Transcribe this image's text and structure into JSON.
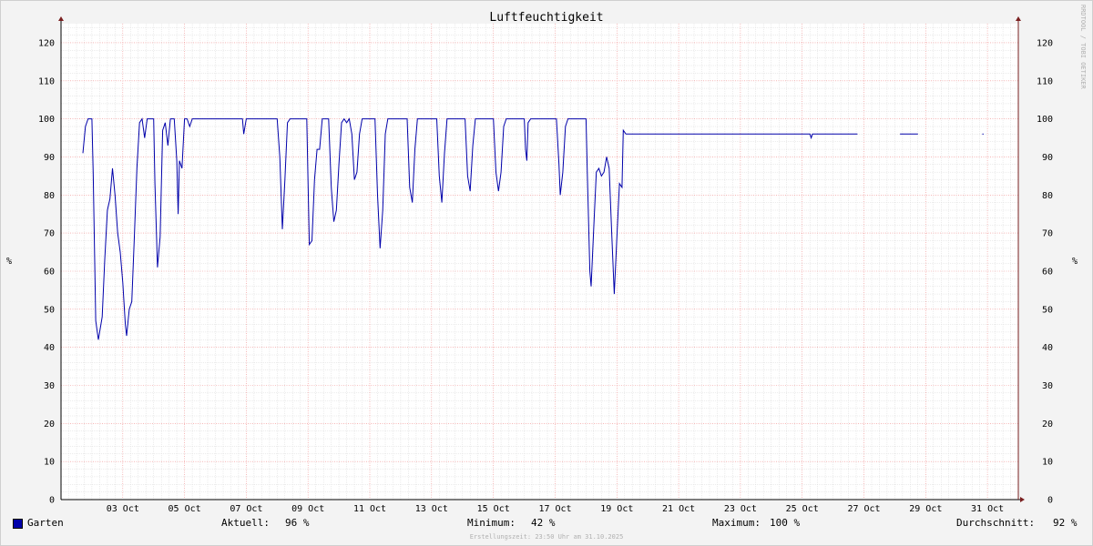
{
  "chart_data": {
    "type": "line",
    "title": "Luftfeuchtigkeit",
    "ylabel": "%",
    "ylim": [
      0,
      125
    ],
    "yticks": [
      0,
      10,
      20,
      30,
      40,
      50,
      60,
      70,
      80,
      90,
      100,
      110,
      120
    ],
    "xlim": [
      "01 Oct",
      "31 Oct 23:59"
    ],
    "xticks": [
      "03 Oct",
      "05 Oct",
      "07 Oct",
      "09 Oct",
      "11 Oct",
      "13 Oct",
      "15 Oct",
      "17 Oct",
      "19 Oct",
      "21 Oct",
      "23 Oct",
      "25 Oct",
      "27 Oct",
      "29 Oct",
      "31 Oct"
    ],
    "grid": true,
    "series": [
      {
        "name": "Garten",
        "color": "#0000aa",
        "segments": [
          [
            [
              "01 Oct 17:00",
              91
            ],
            [
              "01 Oct 19:00",
              98
            ],
            [
              "01 Oct 21:00",
              100
            ],
            [
              "02 Oct 00:00",
              100
            ],
            [
              "02 Oct 01:00",
              86
            ],
            [
              "02 Oct 03:00",
              47
            ],
            [
              "02 Oct 05:00",
              42
            ],
            [
              "02 Oct 08:00",
              48
            ],
            [
              "02 Oct 10:00",
              63
            ],
            [
              "02 Oct 12:00",
              76
            ],
            [
              "02 Oct 14:00",
              79
            ],
            [
              "02 Oct 16:00",
              87
            ],
            [
              "02 Oct 18:00",
              80
            ],
            [
              "02 Oct 20:00",
              70
            ],
            [
              "02 Oct 22:00",
              65
            ],
            [
              "03 Oct 00:00",
              57
            ],
            [
              "03 Oct 02:00",
              46
            ],
            [
              "03 Oct 03:00",
              43
            ],
            [
              "03 Oct 05:00",
              50
            ],
            [
              "03 Oct 07:00",
              52
            ],
            [
              "03 Oct 09:00",
              69
            ],
            [
              "03 Oct 11:00",
              87
            ],
            [
              "03 Oct 13:00",
              99
            ],
            [
              "03 Oct 15:00",
              100
            ],
            [
              "03 Oct 17:00",
              95
            ],
            [
              "03 Oct 19:00",
              100
            ],
            [
              "04 Oct 00:00",
              100
            ],
            [
              "04 Oct 01:00",
              83
            ],
            [
              "04 Oct 03:00",
              61
            ],
            [
              "04 Oct 05:00",
              69
            ],
            [
              "04 Oct 07:00",
              97
            ],
            [
              "04 Oct 09:00",
              99
            ],
            [
              "04 Oct 11:00",
              93
            ],
            [
              "04 Oct 13:00",
              100
            ],
            [
              "04 Oct 16:00",
              100
            ],
            [
              "04 Oct 18:00",
              89
            ],
            [
              "04 Oct 19:00",
              75
            ],
            [
              "04 Oct 20:00",
              89
            ],
            [
              "04 Oct 22:00",
              87
            ],
            [
              "05 Oct 00:00",
              100
            ],
            [
              "05 Oct 02:00",
              100
            ],
            [
              "05 Oct 04:00",
              98
            ],
            [
              "05 Oct 06:00",
              100
            ],
            [
              "06 Oct 21:00",
              100
            ],
            [
              "06 Oct 22:00",
              96
            ],
            [
              "07 Oct 00:00",
              100
            ],
            [
              "08 Oct 00:00",
              100
            ],
            [
              "08 Oct 02:00",
              90
            ],
            [
              "08 Oct 04:00",
              71
            ],
            [
              "08 Oct 06:00",
              84
            ],
            [
              "08 Oct 08:00",
              99
            ],
            [
              "08 Oct 10:00",
              100
            ],
            [
              "08 Oct 23:00",
              100
            ],
            [
              "09 Oct 01:00",
              67
            ],
            [
              "09 Oct 03:00",
              68
            ],
            [
              "09 Oct 05:00",
              84
            ],
            [
              "09 Oct 07:00",
              92
            ],
            [
              "09 Oct 09:00",
              92
            ],
            [
              "09 Oct 11:00",
              100
            ],
            [
              "09 Oct 16:00",
              100
            ],
            [
              "09 Oct 18:00",
              82
            ],
            [
              "09 Oct 20:00",
              73
            ],
            [
              "09 Oct 22:00",
              76
            ],
            [
              "10 Oct 00:00",
              88
            ],
            [
              "10 Oct 02:00",
              99
            ],
            [
              "10 Oct 04:00",
              100
            ],
            [
              "10 Oct 06:00",
              99
            ],
            [
              "10 Oct 08:00",
              100
            ],
            [
              "10 Oct 10:00",
              96
            ],
            [
              "10 Oct 12:00",
              84
            ],
            [
              "10 Oct 14:00",
              86
            ],
            [
              "10 Oct 16:00",
              96
            ],
            [
              "10 Oct 18:00",
              100
            ],
            [
              "11 Oct 04:00",
              100
            ],
            [
              "11 Oct 06:00",
              80
            ],
            [
              "11 Oct 08:00",
              66
            ],
            [
              "11 Oct 10:00",
              76
            ],
            [
              "11 Oct 12:00",
              96
            ],
            [
              "11 Oct 14:00",
              100
            ],
            [
              "12 Oct 05:00",
              100
            ],
            [
              "12 Oct 07:00",
              82
            ],
            [
              "12 Oct 09:00",
              78
            ],
            [
              "12 Oct 11:00",
              92
            ],
            [
              "12 Oct 13:00",
              100
            ],
            [
              "13 Oct 04:00",
              100
            ],
            [
              "13 Oct 06:00",
              85
            ],
            [
              "13 Oct 08:00",
              78
            ],
            [
              "13 Oct 10:00",
              91
            ],
            [
              "13 Oct 12:00",
              100
            ],
            [
              "14 Oct 02:00",
              100
            ],
            [
              "14 Oct 04:00",
              85
            ],
            [
              "14 Oct 06:00",
              81
            ],
            [
              "14 Oct 08:00",
              93
            ],
            [
              "14 Oct 10:00",
              100
            ],
            [
              "15 Oct 00:00",
              100
            ],
            [
              "15 Oct 02:00",
              86
            ],
            [
              "15 Oct 04:00",
              81
            ],
            [
              "15 Oct 06:00",
              86
            ],
            [
              "15 Oct 08:00",
              98
            ],
            [
              "15 Oct 10:00",
              100
            ],
            [
              "16 Oct 00:00",
              100
            ],
            [
              "16 Oct 01:00",
              92
            ],
            [
              "16 Oct 02:00",
              89
            ],
            [
              "16 Oct 03:00",
              99
            ],
            [
              "16 Oct 05:00",
              100
            ],
            [
              "17 Oct 01:00",
              100
            ],
            [
              "17 Oct 03:00",
              88
            ],
            [
              "17 Oct 04:00",
              80
            ],
            [
              "17 Oct 06:00",
              86
            ],
            [
              "17 Oct 08:00",
              98
            ],
            [
              "17 Oct 10:00",
              100
            ],
            [
              "18 Oct 00:00",
              100
            ],
            [
              "18 Oct 01:00",
              86
            ],
            [
              "18 Oct 03:00",
              60
            ],
            [
              "18 Oct 04:00",
              56
            ],
            [
              "18 Oct 06:00",
              71
            ],
            [
              "18 Oct 08:00",
              86
            ],
            [
              "18 Oct 10:00",
              87
            ],
            [
              "18 Oct 12:00",
              85
            ],
            [
              "18 Oct 14:00",
              86
            ],
            [
              "18 Oct 16:00",
              90
            ],
            [
              "18 Oct 18:00",
              87
            ],
            [
              "18 Oct 20:00",
              70
            ],
            [
              "18 Oct 22:00",
              54
            ],
            [
              "19 Oct 00:00",
              69
            ],
            [
              "19 Oct 02:00",
              83
            ],
            [
              "19 Oct 04:00",
              82
            ],
            [
              "19 Oct 05:00",
              97
            ],
            [
              "19 Oct 07:00",
              96
            ],
            [
              "25 Oct 06:00",
              96
            ],
            [
              "25 Oct 07:00",
              95
            ],
            [
              "25 Oct 08:00",
              96
            ],
            [
              "26 Oct 19:00",
              96
            ]
          ],
          [
            [
              "28 Oct 04:00",
              96
            ],
            [
              "28 Oct 18:00",
              96
            ]
          ],
          [
            [
              "30 Oct 20:00",
              96
            ],
            [
              "30 Oct 21:00",
              96
            ]
          ]
        ]
      }
    ]
  },
  "watermark": "RRDTOOL / TOBI OETIKER",
  "footer": "Erstellungszeit: 23:50 Uhr am 31.10.2025",
  "legend": {
    "series_name": "Garten",
    "current_label": "Aktuell:",
    "current_value": "96 %",
    "min_label": "Minimum:",
    "min_value": "42 %",
    "max_label": "Maximum:",
    "max_value": "100 %",
    "avg_label": "Durchschnitt:",
    "avg_value": "92 %"
  }
}
